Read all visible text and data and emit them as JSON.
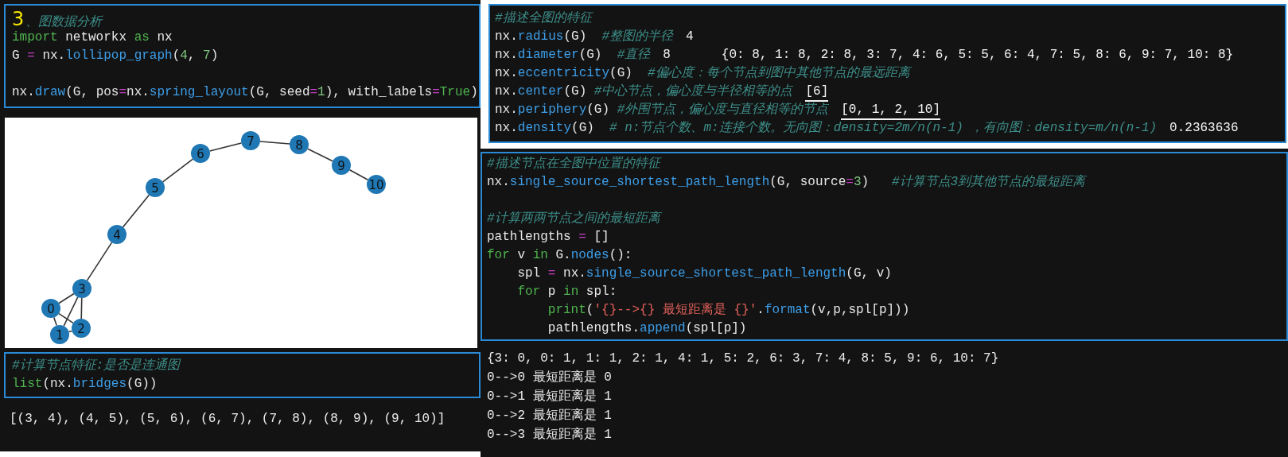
{
  "left": {
    "cell_1": {
      "annotation": "3",
      "lines": [
        {
          "kind": "code",
          "tokens": [
            {
              "kind": "comment",
              "text": "、图数据分析"
            }
          ]
        },
        {
          "kind": "code",
          "tokens": [
            {
              "kind": "keyword",
              "text": "import"
            },
            {
              "kind": "plain",
              "text": " networkx "
            },
            {
              "kind": "keyword",
              "text": "as"
            },
            {
              "kind": "plain",
              "text": " nx"
            }
          ]
        },
        {
          "kind": "code",
          "tokens": [
            {
              "kind": "plain",
              "text": "G "
            },
            {
              "kind": "operator",
              "text": "="
            },
            {
              "kind": "plain",
              "text": " nx."
            },
            {
              "kind": "function",
              "text": "lollipop_graph"
            },
            {
              "kind": "plain",
              "text": "("
            },
            {
              "kind": "number",
              "text": "4"
            },
            {
              "kind": "plain",
              "text": ", "
            },
            {
              "kind": "number",
              "text": "7"
            },
            {
              "kind": "plain",
              "text": ")"
            }
          ]
        },
        {
          "kind": "blank"
        },
        {
          "kind": "code",
          "tokens": [
            {
              "kind": "plain",
              "text": "nx."
            },
            {
              "kind": "function",
              "text": "draw"
            },
            {
              "kind": "plain",
              "text": "(G, pos"
            },
            {
              "kind": "operator",
              "text": "="
            },
            {
              "kind": "plain",
              "text": "nx."
            },
            {
              "kind": "function",
              "text": "spring_layout"
            },
            {
              "kind": "plain",
              "text": "(G, seed"
            },
            {
              "kind": "operator",
              "text": "="
            },
            {
              "kind": "number",
              "text": "1"
            },
            {
              "kind": "plain",
              "text": "), with_labels"
            },
            {
              "kind": "operator",
              "text": "="
            },
            {
              "kind": "keyword",
              "text": "True"
            },
            {
              "kind": "plain",
              "text": ")"
            }
          ]
        }
      ]
    },
    "graph": {
      "nodes": [
        "0",
        "1",
        "2",
        "3",
        "4",
        "5",
        "6",
        "7",
        "8",
        "9",
        "10"
      ]
    },
    "cell_2": {
      "lines": [
        {
          "kind": "code",
          "tokens": [
            {
              "kind": "comment",
              "text": "#计算节点特征:是否是连通图"
            }
          ]
        },
        {
          "kind": "code",
          "tokens": [
            {
              "kind": "builtin",
              "text": "list"
            },
            {
              "kind": "plain",
              "text": "(nx."
            },
            {
              "kind": "function",
              "text": "bridges"
            },
            {
              "kind": "plain",
              "text": "(G))"
            }
          ]
        }
      ]
    },
    "output_2": [
      "[(3, 4), (4, 5), (5, 6), (6, 7), (7, 8), (8, 9), (9, 10)]"
    ]
  },
  "right": {
    "cell_1": {
      "lines": [
        {
          "kind": "code",
          "tokens": [
            {
              "kind": "comment",
              "text": "#描述全图的特征"
            }
          ]
        },
        {
          "kind": "code",
          "tokens": [
            {
              "kind": "plain",
              "text": "nx."
            },
            {
              "kind": "function",
              "text": "radius"
            },
            {
              "kind": "plain",
              "text": "(G)  "
            },
            {
              "kind": "comment",
              "text": "#整图的半径"
            }
          ],
          "results": [
            {
              "text": "4",
              "underlined": false
            }
          ]
        },
        {
          "kind": "code",
          "tokens": [
            {
              "kind": "plain",
              "text": "nx."
            },
            {
              "kind": "function",
              "text": "diameter"
            },
            {
              "kind": "plain",
              "text": "(G)  "
            },
            {
              "kind": "comment",
              "text": "#直径"
            }
          ],
          "results": [
            {
              "text": "8",
              "underlined": false
            },
            {
              "text": "{0: 8, 1: 8, 2: 8, 3: 7, 4: 6, 5: 5, 6: 4, 7: 5, 8: 6, 9: 7, 10: 8}",
              "underlined": false
            }
          ]
        },
        {
          "kind": "code",
          "tokens": [
            {
              "kind": "plain",
              "text": "nx."
            },
            {
              "kind": "function",
              "text": "eccentricity"
            },
            {
              "kind": "plain",
              "text": "(G)  "
            },
            {
              "kind": "comment",
              "text": "#偏心度：每个节点到图中其他节点的最远距离"
            }
          ]
        },
        {
          "kind": "code",
          "tokens": [
            {
              "kind": "plain",
              "text": "nx."
            },
            {
              "kind": "function",
              "text": "center"
            },
            {
              "kind": "plain",
              "text": "(G) "
            },
            {
              "kind": "comment",
              "text": "#中心节点，偏心度与半径相等的点"
            }
          ],
          "results": [
            {
              "text": "[6]",
              "underlined": true
            }
          ]
        },
        {
          "kind": "code",
          "tokens": [
            {
              "kind": "plain",
              "text": "nx."
            },
            {
              "kind": "function",
              "text": "periphery"
            },
            {
              "kind": "plain",
              "text": "(G) "
            },
            {
              "kind": "comment",
              "text": "#外围节点，偏心度与直径相等的节点"
            }
          ],
          "results": [
            {
              "text": "[0, 1, 2, 10]",
              "underlined": true
            }
          ]
        },
        {
          "kind": "code",
          "tokens": [
            {
              "kind": "plain",
              "text": "nx."
            },
            {
              "kind": "function",
              "text": "density"
            },
            {
              "kind": "plain",
              "text": "(G)  "
            },
            {
              "kind": "comment",
              "text": "# n:节点个数、m:连接个数。无向图：density=2m/n(n-1) ，有向图：density=m/n(n-1)"
            }
          ],
          "results": [
            {
              "text": "0.2363636",
              "underlined": false
            }
          ]
        }
      ]
    },
    "cell_2": {
      "lines": [
        {
          "kind": "code",
          "tokens": [
            {
              "kind": "comment",
              "text": "#描述节点在全图中位置的特征"
            }
          ]
        },
        {
          "kind": "code",
          "tokens": [
            {
              "kind": "plain",
              "text": "nx."
            },
            {
              "kind": "function",
              "text": "single_source_shortest_path_length"
            },
            {
              "kind": "plain",
              "text": "(G, source"
            },
            {
              "kind": "operator",
              "text": "="
            },
            {
              "kind": "number",
              "text": "3"
            },
            {
              "kind": "plain",
              "text": ")   "
            },
            {
              "kind": "comment",
              "text": "#计算节点3到其他节点的最短距离"
            }
          ]
        },
        {
          "kind": "blank"
        },
        {
          "kind": "code",
          "tokens": [
            {
              "kind": "comment",
              "text": "#计算两两节点之间的最短距离"
            }
          ]
        },
        {
          "kind": "code",
          "tokens": [
            {
              "kind": "plain",
              "text": "pathlengths "
            },
            {
              "kind": "operator",
              "text": "="
            },
            {
              "kind": "plain",
              "text": " []"
            }
          ]
        },
        {
          "kind": "code",
          "tokens": [
            {
              "kind": "keyword",
              "text": "for"
            },
            {
              "kind": "plain",
              "text": " v "
            },
            {
              "kind": "keyword",
              "text": "in"
            },
            {
              "kind": "plain",
              "text": " G."
            },
            {
              "kind": "function",
              "text": "nodes"
            },
            {
              "kind": "plain",
              "text": "():"
            }
          ]
        },
        {
          "kind": "code",
          "tokens": [
            {
              "kind": "plain",
              "text": "    spl "
            },
            {
              "kind": "operator",
              "text": "="
            },
            {
              "kind": "plain",
              "text": " nx."
            },
            {
              "kind": "function",
              "text": "single_source_shortest_path_length"
            },
            {
              "kind": "plain",
              "text": "(G, v)"
            }
          ]
        },
        {
          "kind": "code",
          "tokens": [
            {
              "kind": "keyword",
              "text": "    for"
            },
            {
              "kind": "plain",
              "text": " p "
            },
            {
              "kind": "keyword",
              "text": "in"
            },
            {
              "kind": "plain",
              "text": " spl:"
            }
          ]
        },
        {
          "kind": "code",
          "tokens": [
            {
              "kind": "builtin",
              "text": "        print"
            },
            {
              "kind": "plain",
              "text": "("
            },
            {
              "kind": "string",
              "text": "'{}-->{} 最短距离是 {}'"
            },
            {
              "kind": "plain",
              "text": "."
            },
            {
              "kind": "function",
              "text": "format"
            },
            {
              "kind": "plain",
              "text": "(v,p,spl[p]))"
            }
          ]
        },
        {
          "kind": "code",
          "tokens": [
            {
              "kind": "plain",
              "text": "        pathlengths."
            },
            {
              "kind": "function",
              "text": "append"
            },
            {
              "kind": "plain",
              "text": "(spl[p])"
            }
          ]
        }
      ]
    },
    "output_2": [
      "{3: 0, 0: 1, 1: 1, 2: 1, 4: 1, 5: 2, 6: 3, 7: 4, 8: 5, 9: 6, 10: 7}",
      "0-->0 最短距离是 0",
      "0-->1 最短距离是 1",
      "0-->2 最短距离是 1",
      "0-->3 最短距离是 1"
    ]
  }
}
